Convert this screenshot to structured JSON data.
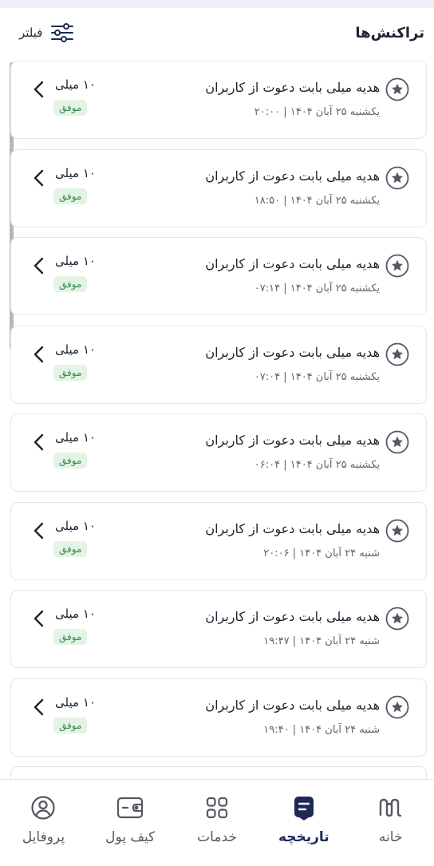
{
  "header": {
    "title": "تراکنش‌ها",
    "filter_label": "فیلتر"
  },
  "transactions": [
    {
      "title": "هدیه میلی بابت دعوت از کاربران",
      "date": "یکشنبه ۲۵ آبان ۱۴۰۴ | ۲۰:۰۰",
      "amount": "۱۰ میلی",
      "status": "موفق"
    },
    {
      "title": "هدیه میلی بابت دعوت از کاربران",
      "date": "یکشنبه ۲۵ آبان ۱۴۰۴ | ۱۸:۵۰",
      "amount": "۱۰ میلی",
      "status": "موفق"
    },
    {
      "title": "هدیه میلی بابت دعوت از کاربران",
      "date": "یکشنبه ۲۵ آبان ۱۴۰۴ | ۰۷:۱۴",
      "amount": "۱۰ میلی",
      "status": "موفق"
    },
    {
      "title": "هدیه میلی بابت دعوت از کاربران",
      "date": "یکشنبه ۲۵ آبان ۱۴۰۴ | ۰۷:۰۴",
      "amount": "۱۰ میلی",
      "status": "موفق"
    },
    {
      "title": "هدیه میلی بابت دعوت از کاربران",
      "date": "یکشنبه ۲۵ آبان ۱۴۰۴ | ۰۶:۰۴",
      "amount": "۱۰ میلی",
      "status": "موفق"
    },
    {
      "title": "هدیه میلی بابت دعوت از کاربران",
      "date": "شنبه ۲۴ آبان ۱۴۰۴ | ۲۰:۰۶",
      "amount": "۱۰ میلی",
      "status": "موفق"
    },
    {
      "title": "هدیه میلی بابت دعوت از کاربران",
      "date": "شنبه ۲۴ آبان ۱۴۰۴ | ۱۹:۴۷",
      "amount": "۱۰ میلی",
      "status": "موفق"
    },
    {
      "title": "هدیه میلی بابت دعوت از کاربران",
      "date": "شنبه ۲۴ آبان ۱۴۰۴ | ۱۹:۴۰",
      "amount": "۱۰ میلی",
      "status": "موفق"
    }
  ],
  "nav": {
    "home": "خانه",
    "history": "تاریخچه",
    "services": "خدمات",
    "wallet": "کیف پول",
    "profile": "پروفایل"
  },
  "colors": {
    "accent": "#1d2a55",
    "success_bg": "#e3f4e6",
    "success_text": "#3d8a50",
    "border": "#e6e7ec"
  }
}
